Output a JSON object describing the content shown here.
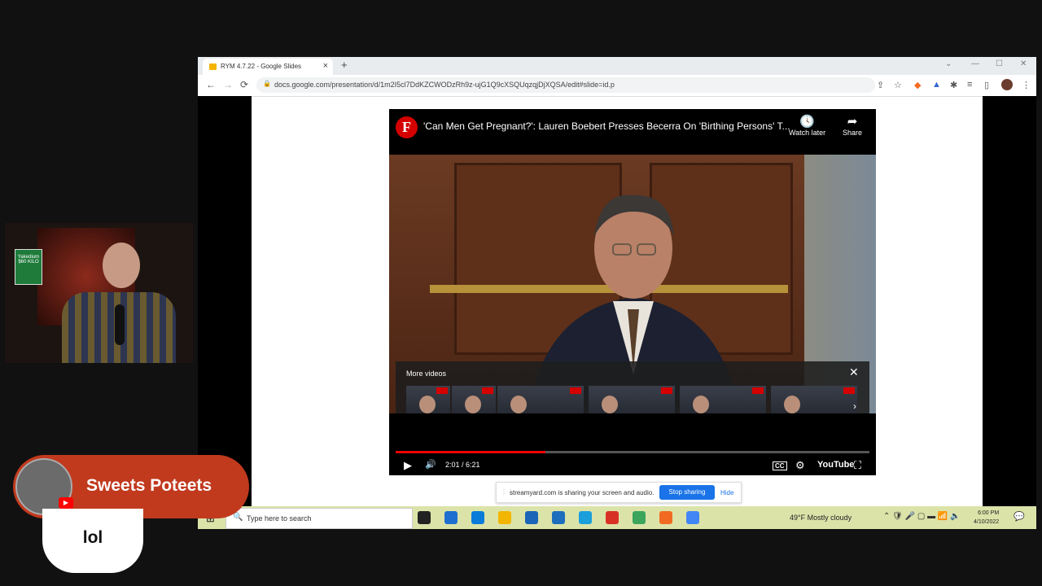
{
  "browser": {
    "tab_title": "RYM 4.7.22 - Google Slides",
    "tab_close": "×",
    "new_tab": "+",
    "window_controls": [
      "⌄",
      "—",
      "☐",
      "✕"
    ],
    "url": "docs.google.com/presentation/d/1m2I5cl7DdKZCWODzRh9z-ujG1Q9cXSQUqzqjDjXQSA/edit#slide=id.p",
    "nav": {
      "back": "←",
      "forward": "→",
      "reload": "⟳"
    },
    "extensions": [
      "⇪",
      "☆",
      "◆",
      "▲",
      "✱",
      "≡",
      "▯",
      "⋮"
    ]
  },
  "video": {
    "channel_logo": "F",
    "title": "'Can Men Get Pregnant?': Lauren Boebert Presses Becerra On 'Birthing Persons' T...",
    "watch_later": "Watch later",
    "share": "Share",
    "more_videos_label": "More videos",
    "more_videos_close": "✕",
    "more_videos_next": "›",
    "time": "2:01 / 6:21",
    "progress_fraction": 0.316,
    "youtube_label": "YouTube",
    "icons": {
      "play": "▶",
      "volume": "🔊",
      "cc": "CC",
      "settings": "⚙",
      "fullscreen": "⛶",
      "watch_later": "🕓",
      "share": "➦"
    }
  },
  "sharing": {
    "message": "streamyard.com is sharing your screen and audio.",
    "stop_button": "Stop sharing",
    "hide_link": "Hide"
  },
  "taskbar": {
    "search_placeholder": "Type here to search",
    "weather": "49°F  Mostly cloudy",
    "time": "6:00 PM",
    "date": "4/10/2022",
    "app_colors": [
      "#222222",
      "#1f6fd1",
      "#0a7bd8",
      "#f2b600",
      "#1b64b7",
      "#1d6fbd",
      "#1a9fdc",
      "#d93025",
      "#3ba55c",
      "#f06b21",
      "#4285f4"
    ]
  },
  "webcam": {
    "sign_text": "Yakedium\n$60 KILO"
  },
  "stream_overlay": {
    "username": "Sweets Poteets",
    "platform_badge": "▶",
    "chat_message": "lol"
  }
}
